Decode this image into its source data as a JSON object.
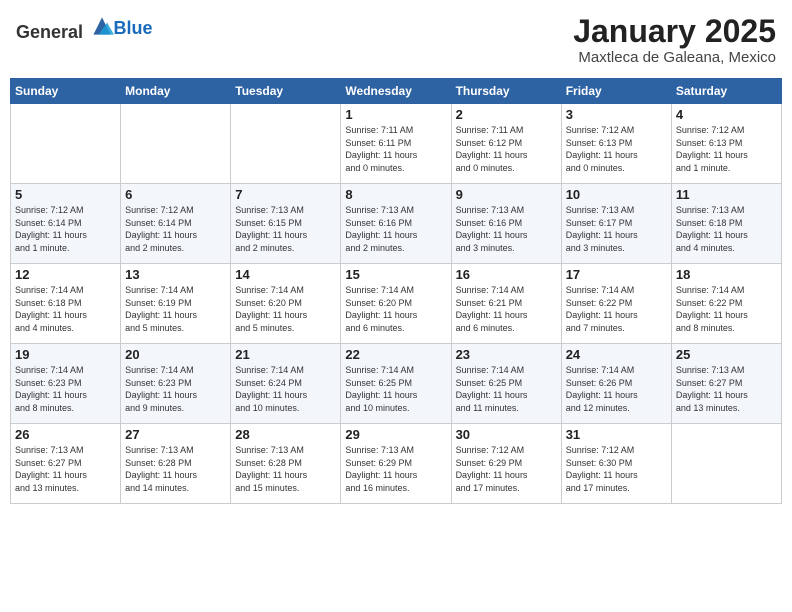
{
  "header": {
    "logo_general": "General",
    "logo_blue": "Blue",
    "title": "January 2025",
    "subtitle": "Maxtleca de Galeana, Mexico"
  },
  "calendar": {
    "days_of_week": [
      "Sunday",
      "Monday",
      "Tuesday",
      "Wednesday",
      "Thursday",
      "Friday",
      "Saturday"
    ],
    "weeks": [
      [
        {
          "day": "",
          "info": ""
        },
        {
          "day": "",
          "info": ""
        },
        {
          "day": "",
          "info": ""
        },
        {
          "day": "1",
          "info": "Sunrise: 7:11 AM\nSunset: 6:11 PM\nDaylight: 11 hours\nand 0 minutes."
        },
        {
          "day": "2",
          "info": "Sunrise: 7:11 AM\nSunset: 6:12 PM\nDaylight: 11 hours\nand 0 minutes."
        },
        {
          "day": "3",
          "info": "Sunrise: 7:12 AM\nSunset: 6:13 PM\nDaylight: 11 hours\nand 0 minutes."
        },
        {
          "day": "4",
          "info": "Sunrise: 7:12 AM\nSunset: 6:13 PM\nDaylight: 11 hours\nand 1 minute."
        }
      ],
      [
        {
          "day": "5",
          "info": "Sunrise: 7:12 AM\nSunset: 6:14 PM\nDaylight: 11 hours\nand 1 minute."
        },
        {
          "day": "6",
          "info": "Sunrise: 7:12 AM\nSunset: 6:14 PM\nDaylight: 11 hours\nand 2 minutes."
        },
        {
          "day": "7",
          "info": "Sunrise: 7:13 AM\nSunset: 6:15 PM\nDaylight: 11 hours\nand 2 minutes."
        },
        {
          "day": "8",
          "info": "Sunrise: 7:13 AM\nSunset: 6:16 PM\nDaylight: 11 hours\nand 2 minutes."
        },
        {
          "day": "9",
          "info": "Sunrise: 7:13 AM\nSunset: 6:16 PM\nDaylight: 11 hours\nand 3 minutes."
        },
        {
          "day": "10",
          "info": "Sunrise: 7:13 AM\nSunset: 6:17 PM\nDaylight: 11 hours\nand 3 minutes."
        },
        {
          "day": "11",
          "info": "Sunrise: 7:13 AM\nSunset: 6:18 PM\nDaylight: 11 hours\nand 4 minutes."
        }
      ],
      [
        {
          "day": "12",
          "info": "Sunrise: 7:14 AM\nSunset: 6:18 PM\nDaylight: 11 hours\nand 4 minutes."
        },
        {
          "day": "13",
          "info": "Sunrise: 7:14 AM\nSunset: 6:19 PM\nDaylight: 11 hours\nand 5 minutes."
        },
        {
          "day": "14",
          "info": "Sunrise: 7:14 AM\nSunset: 6:20 PM\nDaylight: 11 hours\nand 5 minutes."
        },
        {
          "day": "15",
          "info": "Sunrise: 7:14 AM\nSunset: 6:20 PM\nDaylight: 11 hours\nand 6 minutes."
        },
        {
          "day": "16",
          "info": "Sunrise: 7:14 AM\nSunset: 6:21 PM\nDaylight: 11 hours\nand 6 minutes."
        },
        {
          "day": "17",
          "info": "Sunrise: 7:14 AM\nSunset: 6:22 PM\nDaylight: 11 hours\nand 7 minutes."
        },
        {
          "day": "18",
          "info": "Sunrise: 7:14 AM\nSunset: 6:22 PM\nDaylight: 11 hours\nand 8 minutes."
        }
      ],
      [
        {
          "day": "19",
          "info": "Sunrise: 7:14 AM\nSunset: 6:23 PM\nDaylight: 11 hours\nand 8 minutes."
        },
        {
          "day": "20",
          "info": "Sunrise: 7:14 AM\nSunset: 6:23 PM\nDaylight: 11 hours\nand 9 minutes."
        },
        {
          "day": "21",
          "info": "Sunrise: 7:14 AM\nSunset: 6:24 PM\nDaylight: 11 hours\nand 10 minutes."
        },
        {
          "day": "22",
          "info": "Sunrise: 7:14 AM\nSunset: 6:25 PM\nDaylight: 11 hours\nand 10 minutes."
        },
        {
          "day": "23",
          "info": "Sunrise: 7:14 AM\nSunset: 6:25 PM\nDaylight: 11 hours\nand 11 minutes."
        },
        {
          "day": "24",
          "info": "Sunrise: 7:14 AM\nSunset: 6:26 PM\nDaylight: 11 hours\nand 12 minutes."
        },
        {
          "day": "25",
          "info": "Sunrise: 7:13 AM\nSunset: 6:27 PM\nDaylight: 11 hours\nand 13 minutes."
        }
      ],
      [
        {
          "day": "26",
          "info": "Sunrise: 7:13 AM\nSunset: 6:27 PM\nDaylight: 11 hours\nand 13 minutes."
        },
        {
          "day": "27",
          "info": "Sunrise: 7:13 AM\nSunset: 6:28 PM\nDaylight: 11 hours\nand 14 minutes."
        },
        {
          "day": "28",
          "info": "Sunrise: 7:13 AM\nSunset: 6:28 PM\nDaylight: 11 hours\nand 15 minutes."
        },
        {
          "day": "29",
          "info": "Sunrise: 7:13 AM\nSunset: 6:29 PM\nDaylight: 11 hours\nand 16 minutes."
        },
        {
          "day": "30",
          "info": "Sunrise: 7:12 AM\nSunset: 6:29 PM\nDaylight: 11 hours\nand 17 minutes."
        },
        {
          "day": "31",
          "info": "Sunrise: 7:12 AM\nSunset: 6:30 PM\nDaylight: 11 hours\nand 17 minutes."
        },
        {
          "day": "",
          "info": ""
        }
      ]
    ]
  }
}
